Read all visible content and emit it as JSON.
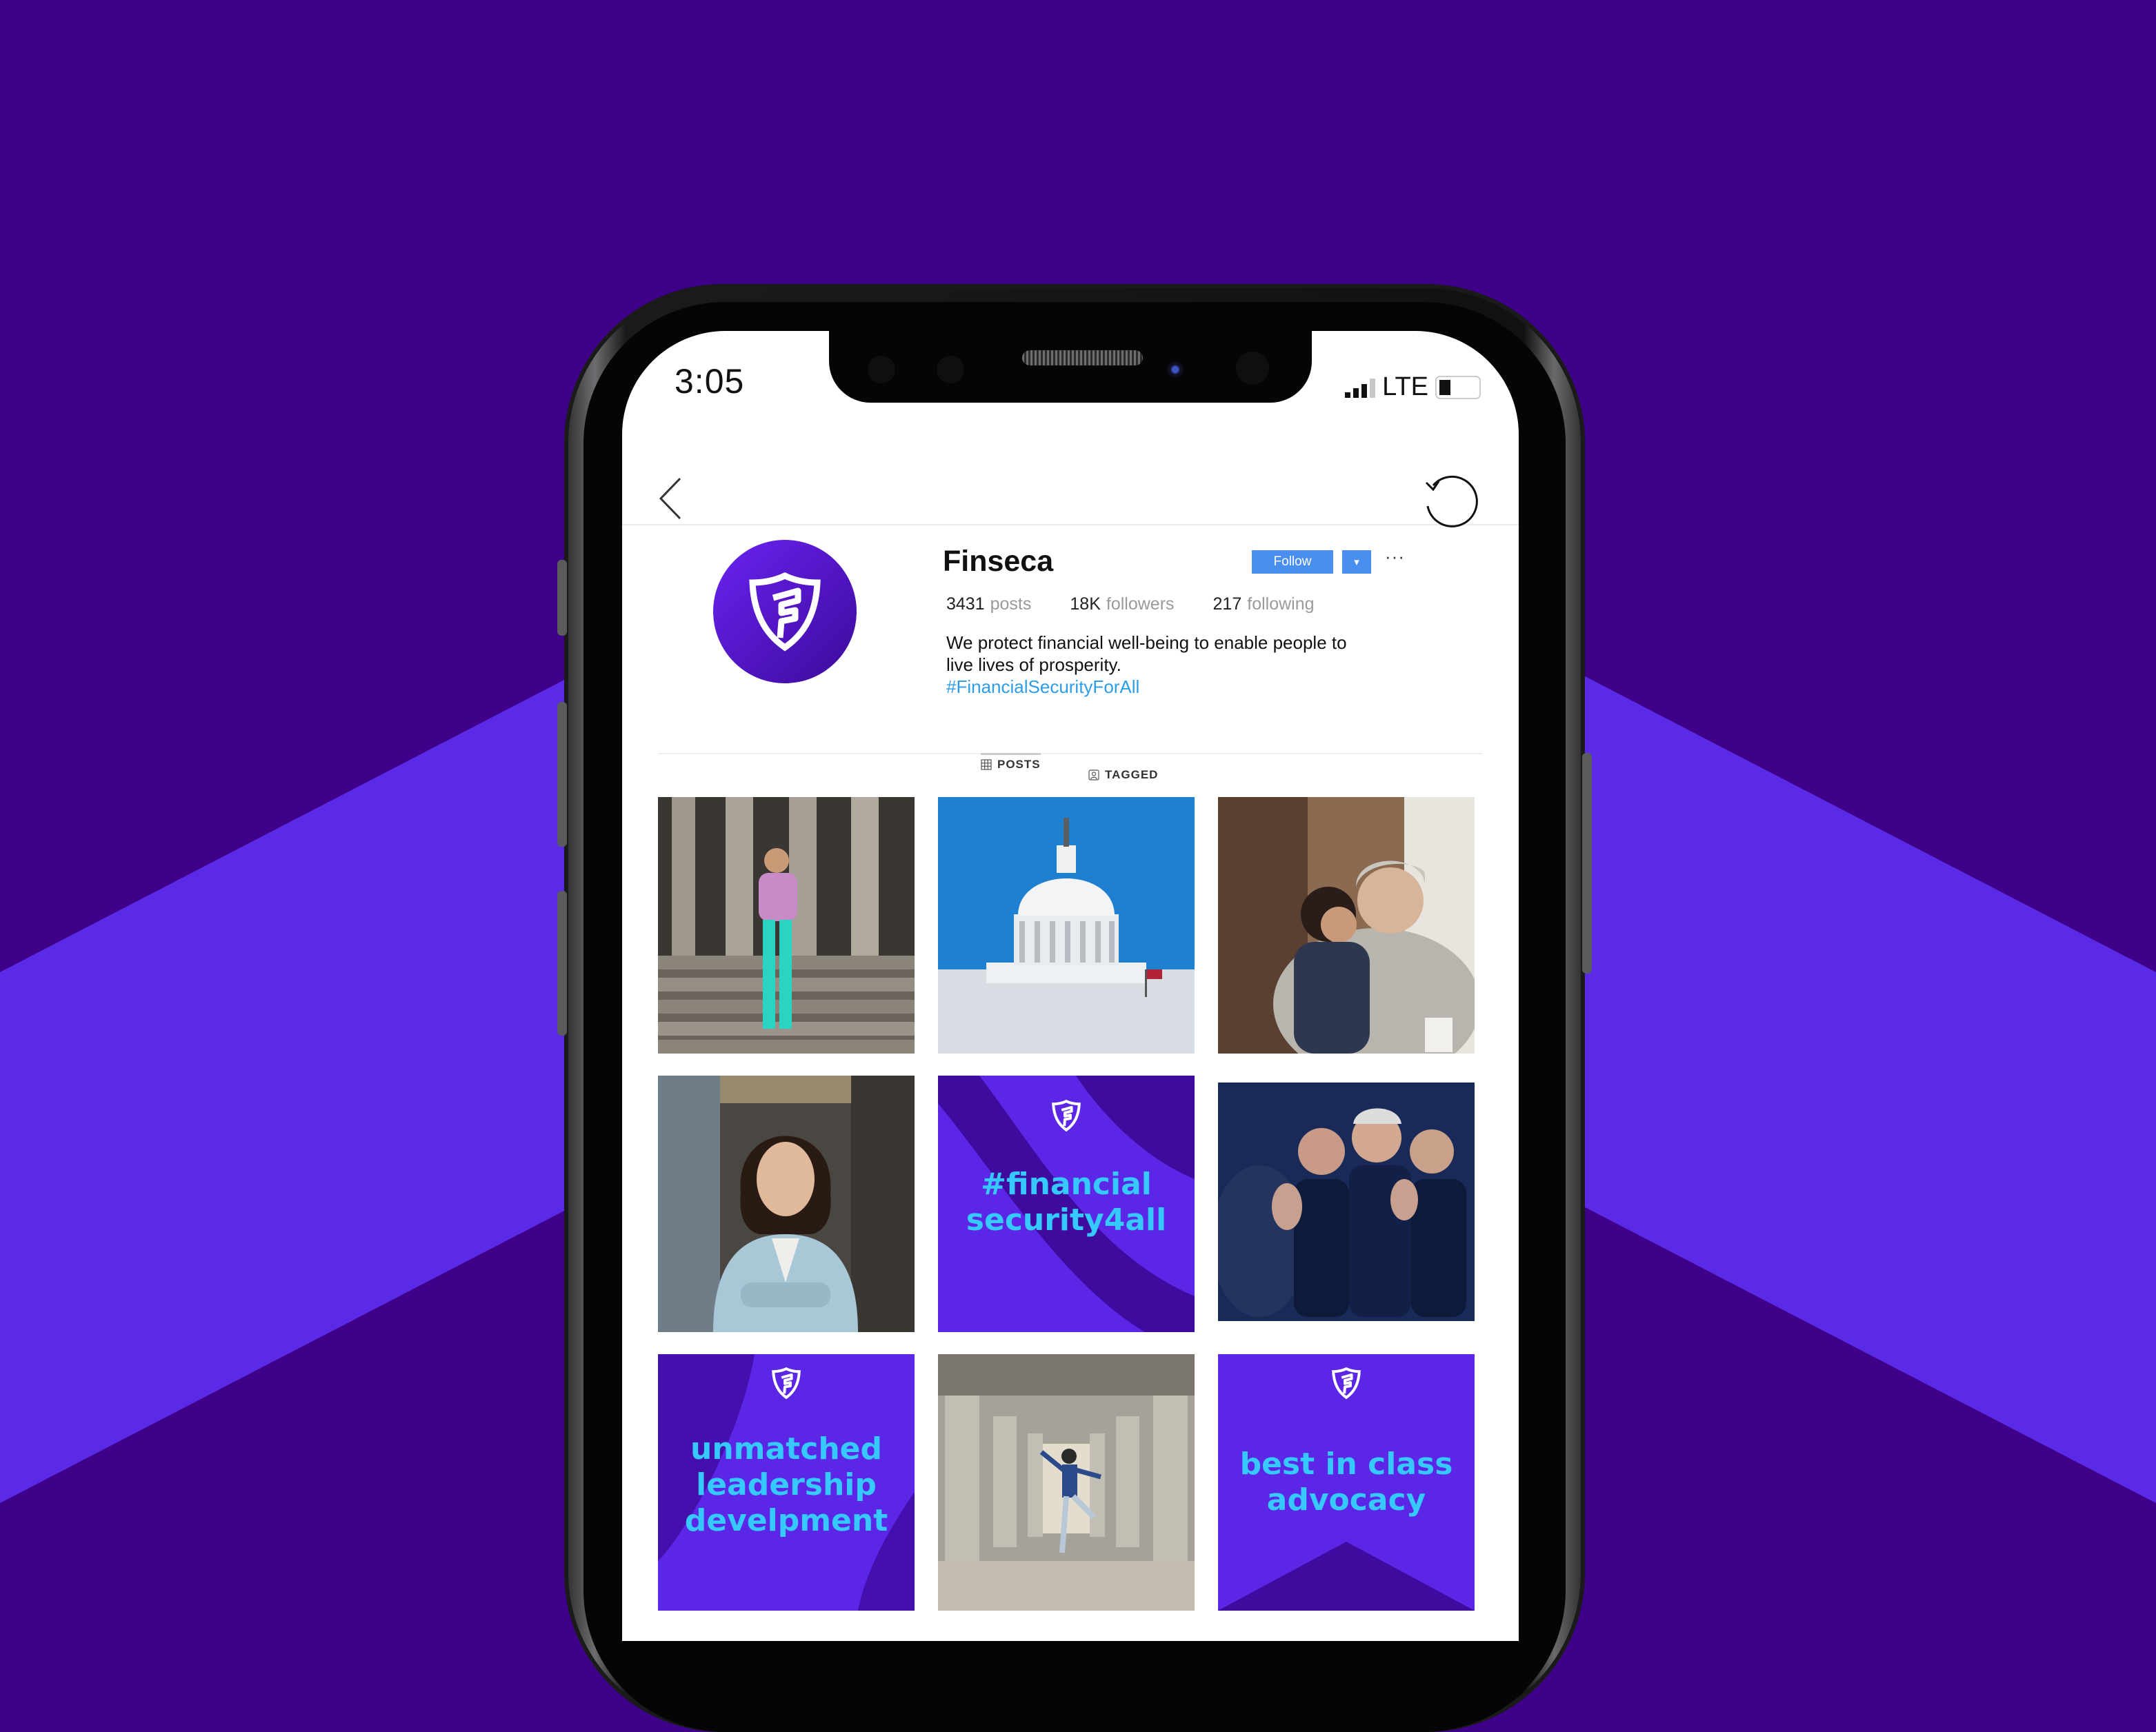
{
  "colors": {
    "bg_dark": "#3f0089",
    "bg_light": "#5b2ae6",
    "brand": "#5b26e6",
    "accent_text": "#36c9ff",
    "follow": "#4a8ef0",
    "hashtag": "#2d9de8"
  },
  "status_bar": {
    "time": "3:05",
    "network": "LTE"
  },
  "nav": {
    "back_icon": "chevron-left-icon",
    "refresh_icon": "refresh-icon"
  },
  "profile": {
    "username": "Finseca",
    "follow_label": "Follow",
    "caret_label": "▾",
    "more_label": "···",
    "stats": {
      "posts_count": "3431",
      "posts_label": "posts",
      "followers_count": "18K",
      "followers_label": "followers",
      "following_count": "217",
      "following_label": "following"
    },
    "bio_line1": "We protect financial well-being to enable people to",
    "bio_line2": "live lives of prosperity.",
    "hashtag": "#FinancialSecurityForAll"
  },
  "tabs": {
    "posts": "POSTS",
    "tagged": "TAGGED"
  },
  "posts": {
    "tile5": {
      "line1": "#financial",
      "line2": "security4all"
    },
    "tile7": {
      "line1": "unmatched",
      "line2": "leadership",
      "line3": "develpment"
    },
    "tile9": {
      "line1": "best in class",
      "line2": "advocacy"
    }
  }
}
